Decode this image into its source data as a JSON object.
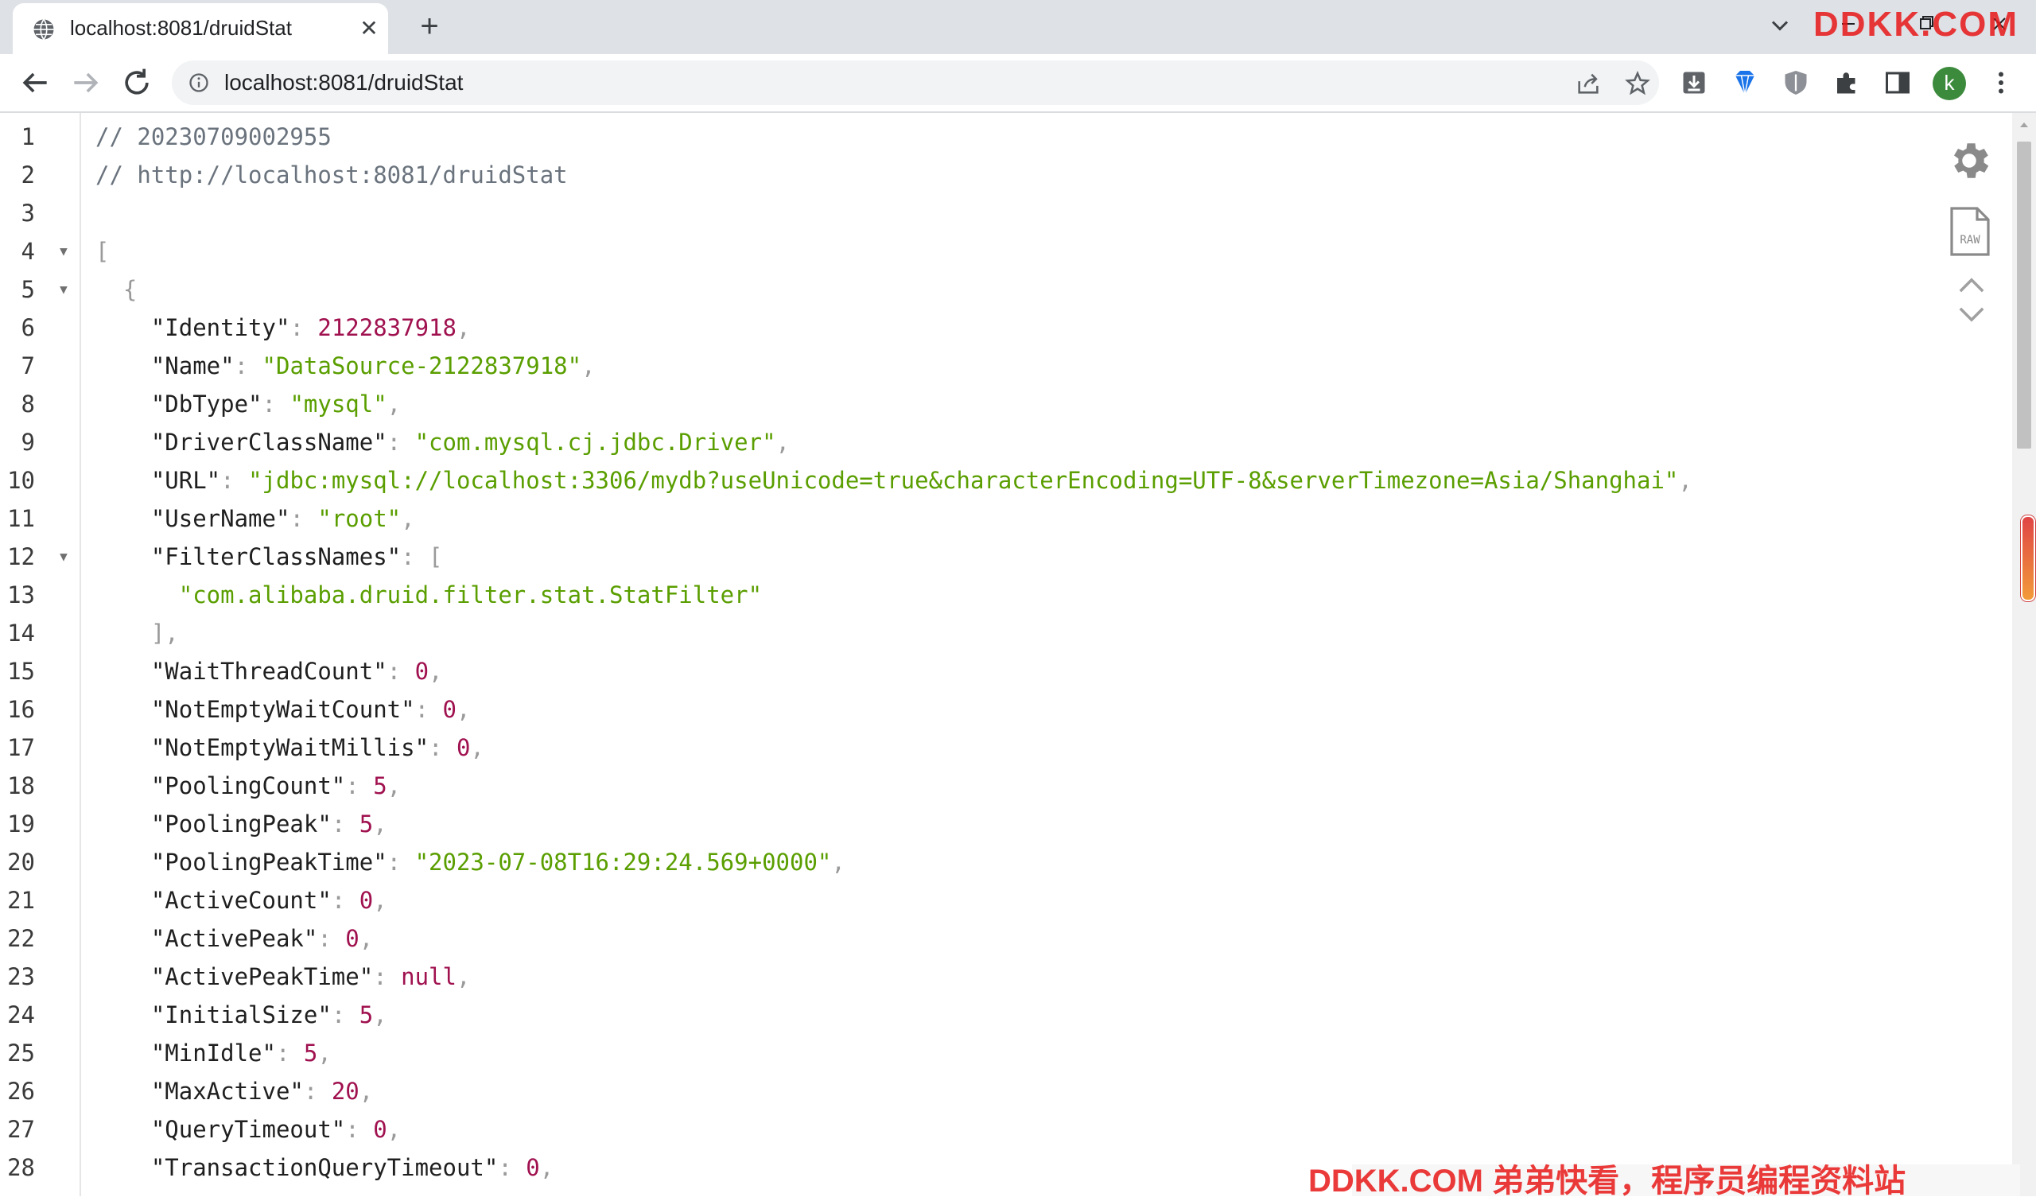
{
  "browser": {
    "tab_title": "localhost:8081/druidStat",
    "url": "localhost:8081/druidStat",
    "avatar_letter": "k",
    "icons": {
      "favicon": "globe-icon",
      "close": "close-icon",
      "new_tab": "plus-icon",
      "tab_search": "chevron-down-icon",
      "back": "back-arrow-icon",
      "forward": "forward-arrow-icon",
      "reload": "reload-icon",
      "site_info": "info-icon",
      "share": "share-icon",
      "bookmark": "star-icon",
      "download": "download-icon",
      "ext1": "diamond-extension-icon",
      "ext2": "shield-extension-icon",
      "extensions": "puzzle-icon",
      "side_panel": "side-panel-icon",
      "menu": "kebab-menu-icon"
    },
    "watermark_top": "DDKK.COM",
    "watermark_bottom": "DDKK.COM 弟弟快看，程序员编程资料站"
  },
  "viewer": {
    "tools": {
      "settings": "gear-icon",
      "raw": "raw-icon",
      "raw_label": "RAW",
      "collapse": "chevron-up-icon",
      "expand": "chevron-down-icon"
    },
    "lines": [
      {
        "n": "1",
        "fold": false,
        "tokens": [
          {
            "t": "// 20230709002955",
            "c": "com"
          }
        ]
      },
      {
        "n": "2",
        "fold": false,
        "tokens": [
          {
            "t": "// http://localhost:8081/druidStat",
            "c": "com"
          }
        ]
      },
      {
        "n": "3",
        "fold": false,
        "tokens": []
      },
      {
        "n": "4",
        "fold": true,
        "tokens": [
          {
            "t": "[",
            "c": "pun"
          }
        ]
      },
      {
        "n": "5",
        "fold": true,
        "tokens": [
          {
            "t": "  {",
            "c": "pun"
          }
        ]
      },
      {
        "n": "6",
        "fold": false,
        "tokens": [
          {
            "t": "    \"Identity\"",
            "c": "key"
          },
          {
            "t": ": ",
            "c": "pun"
          },
          {
            "t": "2122837918",
            "c": "num"
          },
          {
            "t": ",",
            "c": "pun"
          }
        ]
      },
      {
        "n": "7",
        "fold": false,
        "tokens": [
          {
            "t": "    \"Name\"",
            "c": "key"
          },
          {
            "t": ": ",
            "c": "pun"
          },
          {
            "t": "\"DataSource-2122837918\"",
            "c": "str"
          },
          {
            "t": ",",
            "c": "pun"
          }
        ]
      },
      {
        "n": "8",
        "fold": false,
        "tokens": [
          {
            "t": "    \"DbType\"",
            "c": "key"
          },
          {
            "t": ": ",
            "c": "pun"
          },
          {
            "t": "\"mysql\"",
            "c": "str"
          },
          {
            "t": ",",
            "c": "pun"
          }
        ]
      },
      {
        "n": "9",
        "fold": false,
        "tokens": [
          {
            "t": "    \"DriverClassName\"",
            "c": "key"
          },
          {
            "t": ": ",
            "c": "pun"
          },
          {
            "t": "\"com.mysql.cj.jdbc.Driver\"",
            "c": "str"
          },
          {
            "t": ",",
            "c": "pun"
          }
        ]
      },
      {
        "n": "10",
        "fold": false,
        "tokens": [
          {
            "t": "    \"URL\"",
            "c": "key"
          },
          {
            "t": ": ",
            "c": "pun"
          },
          {
            "t": "\"jdbc:mysql://localhost:3306/mydb?useUnicode=true&characterEncoding=UTF-8&serverTimezone=Asia/Shanghai\"",
            "c": "str"
          },
          {
            "t": ",",
            "c": "pun"
          }
        ]
      },
      {
        "n": "11",
        "fold": false,
        "tokens": [
          {
            "t": "    \"UserName\"",
            "c": "key"
          },
          {
            "t": ": ",
            "c": "pun"
          },
          {
            "t": "\"root\"",
            "c": "str"
          },
          {
            "t": ",",
            "c": "pun"
          }
        ]
      },
      {
        "n": "12",
        "fold": true,
        "tokens": [
          {
            "t": "    \"FilterClassNames\"",
            "c": "key"
          },
          {
            "t": ": [",
            "c": "pun"
          }
        ]
      },
      {
        "n": "13",
        "fold": false,
        "tokens": [
          {
            "t": "      \"com.alibaba.druid.filter.stat.StatFilter\"",
            "c": "str"
          }
        ]
      },
      {
        "n": "14",
        "fold": false,
        "tokens": [
          {
            "t": "    ],",
            "c": "pun"
          }
        ]
      },
      {
        "n": "15",
        "fold": false,
        "tokens": [
          {
            "t": "    \"WaitThreadCount\"",
            "c": "key"
          },
          {
            "t": ": ",
            "c": "pun"
          },
          {
            "t": "0",
            "c": "num"
          },
          {
            "t": ",",
            "c": "pun"
          }
        ]
      },
      {
        "n": "16",
        "fold": false,
        "tokens": [
          {
            "t": "    \"NotEmptyWaitCount\"",
            "c": "key"
          },
          {
            "t": ": ",
            "c": "pun"
          },
          {
            "t": "0",
            "c": "num"
          },
          {
            "t": ",",
            "c": "pun"
          }
        ]
      },
      {
        "n": "17",
        "fold": false,
        "tokens": [
          {
            "t": "    \"NotEmptyWaitMillis\"",
            "c": "key"
          },
          {
            "t": ": ",
            "c": "pun"
          },
          {
            "t": "0",
            "c": "num"
          },
          {
            "t": ",",
            "c": "pun"
          }
        ]
      },
      {
        "n": "18",
        "fold": false,
        "tokens": [
          {
            "t": "    \"PoolingCount\"",
            "c": "key"
          },
          {
            "t": ": ",
            "c": "pun"
          },
          {
            "t": "5",
            "c": "num"
          },
          {
            "t": ",",
            "c": "pun"
          }
        ]
      },
      {
        "n": "19",
        "fold": false,
        "tokens": [
          {
            "t": "    \"PoolingPeak\"",
            "c": "key"
          },
          {
            "t": ": ",
            "c": "pun"
          },
          {
            "t": "5",
            "c": "num"
          },
          {
            "t": ",",
            "c": "pun"
          }
        ]
      },
      {
        "n": "20",
        "fold": false,
        "tokens": [
          {
            "t": "    \"PoolingPeakTime\"",
            "c": "key"
          },
          {
            "t": ": ",
            "c": "pun"
          },
          {
            "t": "\"2023-07-08T16:29:24.569+0000\"",
            "c": "str"
          },
          {
            "t": ",",
            "c": "pun"
          }
        ]
      },
      {
        "n": "21",
        "fold": false,
        "tokens": [
          {
            "t": "    \"ActiveCount\"",
            "c": "key"
          },
          {
            "t": ": ",
            "c": "pun"
          },
          {
            "t": "0",
            "c": "num"
          },
          {
            "t": ",",
            "c": "pun"
          }
        ]
      },
      {
        "n": "22",
        "fold": false,
        "tokens": [
          {
            "t": "    \"ActivePeak\"",
            "c": "key"
          },
          {
            "t": ": ",
            "c": "pun"
          },
          {
            "t": "0",
            "c": "num"
          },
          {
            "t": ",",
            "c": "pun"
          }
        ]
      },
      {
        "n": "23",
        "fold": false,
        "tokens": [
          {
            "t": "    \"ActivePeakTime\"",
            "c": "key"
          },
          {
            "t": ": ",
            "c": "pun"
          },
          {
            "t": "null",
            "c": "null"
          },
          {
            "t": ",",
            "c": "pun"
          }
        ]
      },
      {
        "n": "24",
        "fold": false,
        "tokens": [
          {
            "t": "    \"InitialSize\"",
            "c": "key"
          },
          {
            "t": ": ",
            "c": "pun"
          },
          {
            "t": "5",
            "c": "num"
          },
          {
            "t": ",",
            "c": "pun"
          }
        ]
      },
      {
        "n": "25",
        "fold": false,
        "tokens": [
          {
            "t": "    \"MinIdle\"",
            "c": "key"
          },
          {
            "t": ": ",
            "c": "pun"
          },
          {
            "t": "5",
            "c": "num"
          },
          {
            "t": ",",
            "c": "pun"
          }
        ]
      },
      {
        "n": "26",
        "fold": false,
        "tokens": [
          {
            "t": "    \"MaxActive\"",
            "c": "key"
          },
          {
            "t": ": ",
            "c": "pun"
          },
          {
            "t": "20",
            "c": "num"
          },
          {
            "t": ",",
            "c": "pun"
          }
        ]
      },
      {
        "n": "27",
        "fold": false,
        "tokens": [
          {
            "t": "    \"QueryTimeout\"",
            "c": "key"
          },
          {
            "t": ": ",
            "c": "pun"
          },
          {
            "t": "0",
            "c": "num"
          },
          {
            "t": ",",
            "c": "pun"
          }
        ]
      },
      {
        "n": "28",
        "fold": false,
        "tokens": [
          {
            "t": "    \"TransactionQueryTimeout\"",
            "c": "key"
          },
          {
            "t": ": ",
            "c": "pun"
          },
          {
            "t": "0",
            "c": "num"
          },
          {
            "t": ",",
            "c": "pun"
          }
        ]
      }
    ]
  },
  "colors": {
    "string": "#5a9e00",
    "number": "#a0114f",
    "comment": "#6a737d",
    "accent": "#e81818"
  }
}
